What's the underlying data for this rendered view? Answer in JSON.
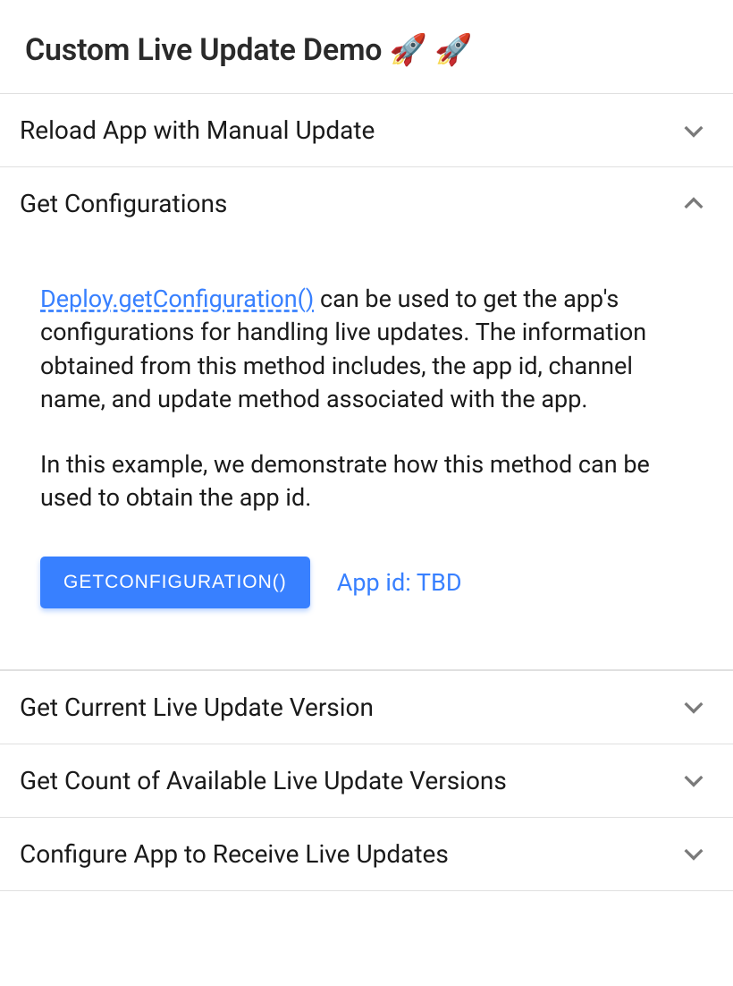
{
  "header": {
    "title": "Custom Live Update Demo 🚀 🚀"
  },
  "accordion": [
    {
      "title": "Reload App with Manual Update",
      "expanded": false
    },
    {
      "title": "Get Configurations",
      "expanded": true,
      "content": {
        "link_text": "Deploy.getConfiguration()",
        "paragraph1_rest": " can be used to get the app's configurations for handling live updates. The information obtained from this method includes, the app id, channel name, and update method associated with the app.",
        "paragraph2": "In this example, we demonstrate how this method can be used to obtain the app id.",
        "button_label": "GetConfiguration()",
        "result_label": "App id: TBD"
      }
    },
    {
      "title": "Get Current Live Update Version",
      "expanded": false
    },
    {
      "title": "Get Count of Available Live Update Versions",
      "expanded": false
    },
    {
      "title": "Configure App to Receive Live Updates",
      "expanded": false
    }
  ]
}
